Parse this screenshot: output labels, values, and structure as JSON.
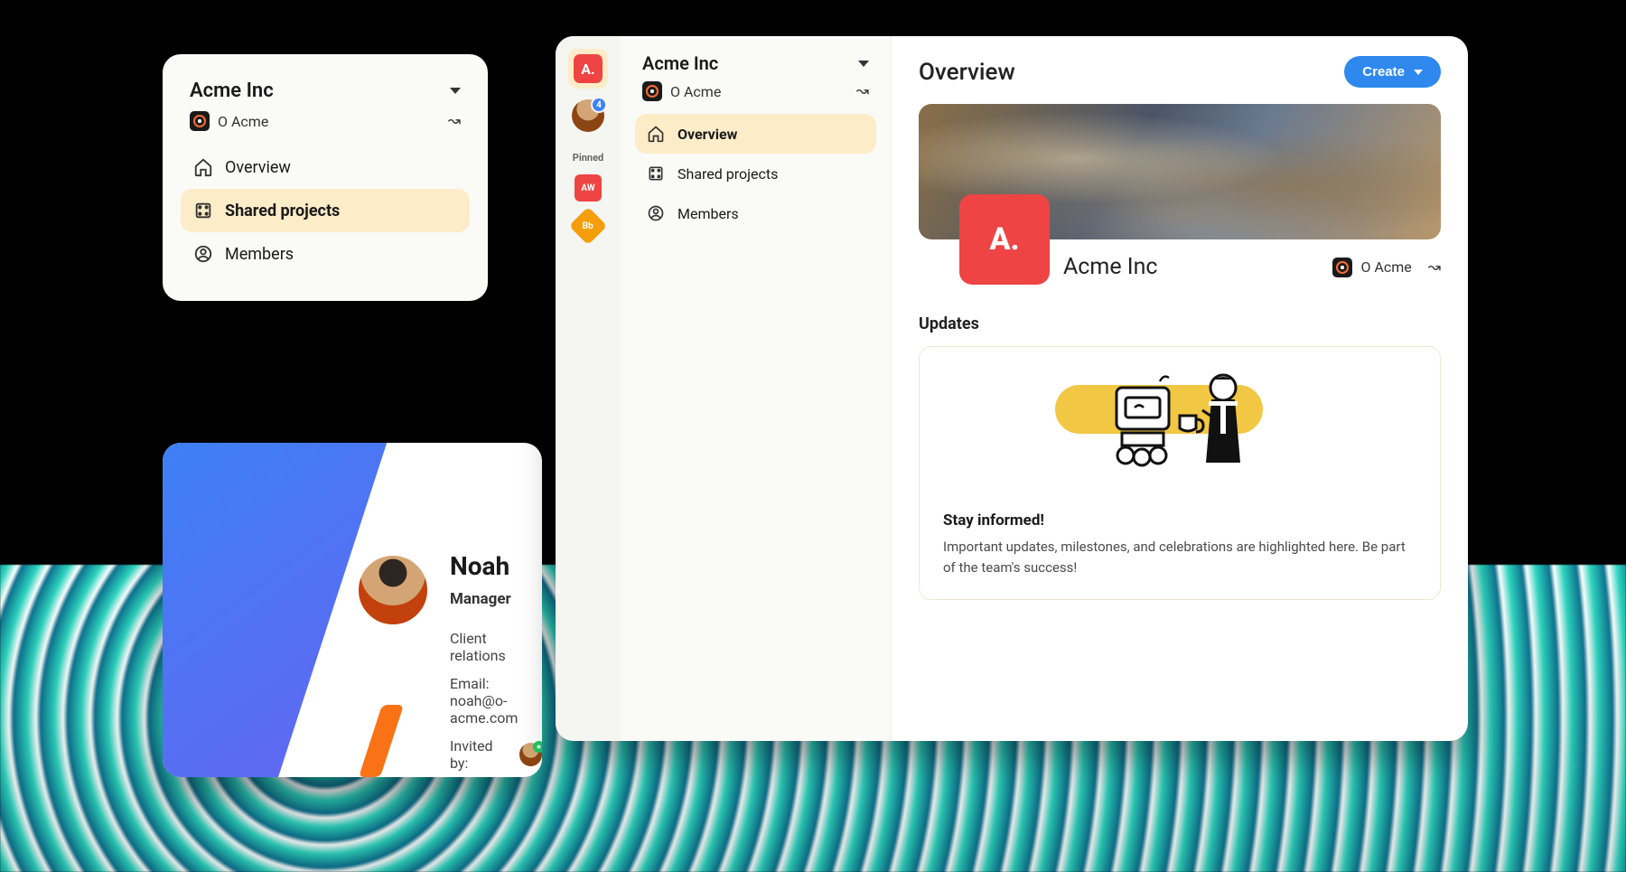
{
  "workspace": {
    "name": "Acme Inc",
    "sub_label": "O Acme"
  },
  "nav1": {
    "overview": "Overview",
    "shared": "Shared projects",
    "members": "Members"
  },
  "profile": {
    "name": "Noah",
    "role": "Manager",
    "dept": "Client relations",
    "email_full": "Email: noah@o-acme.com",
    "invited_label": "Invited by:"
  },
  "rail": {
    "logo": "A.",
    "badge": "4",
    "pinned_label": "Pinned",
    "pin1": "AW",
    "pin2": "Bb"
  },
  "main": {
    "title": "Overview",
    "create": "Create",
    "org_logo": "A.",
    "org_name": "Acme Inc",
    "org_sub": "O Acme",
    "updates_heading": "Updates",
    "updates_title": "Stay informed!",
    "updates_text": "Important updates, milestones, and celebrations are highlighted here. Be part of the team's success!"
  }
}
